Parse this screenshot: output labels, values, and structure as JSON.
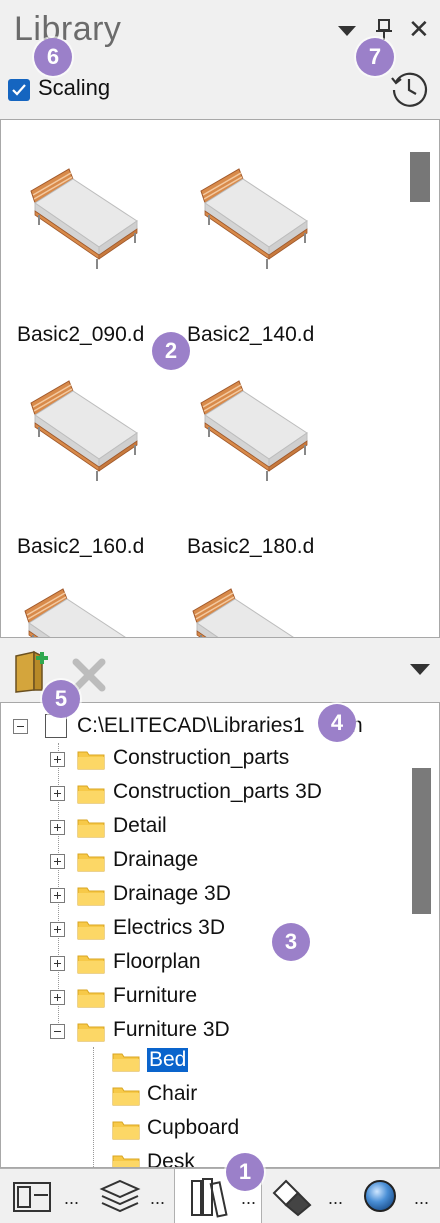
{
  "title": "Library",
  "scaling": {
    "label": "Scaling",
    "checked": true
  },
  "thumbnails": [
    {
      "caption": "Basic2_090.d"
    },
    {
      "caption": "Basic2_140.d"
    },
    {
      "caption": "Basic2_160.d"
    },
    {
      "caption": "Basic2_180.d"
    },
    {
      "caption": ""
    },
    {
      "caption": ""
    }
  ],
  "tree": {
    "root": "C:\\ELITECAD\\Libraries1",
    "root_tail": "n",
    "items": [
      {
        "label": "Construction_parts",
        "expander": "plus"
      },
      {
        "label": "Construction_parts 3D",
        "expander": "plus"
      },
      {
        "label": "Detail",
        "expander": "plus"
      },
      {
        "label": "Drainage",
        "expander": "plus"
      },
      {
        "label": "Drainage 3D",
        "expander": "plus"
      },
      {
        "label": "Electrics 3D",
        "expander": "plus"
      },
      {
        "label": "Floorplan",
        "expander": "plus"
      },
      {
        "label": "Furniture",
        "expander": "plus"
      },
      {
        "label": "Furniture 3D",
        "expander": "minus"
      }
    ],
    "children": [
      {
        "label": "Bed",
        "selected": true
      },
      {
        "label": "Chair"
      },
      {
        "label": "Cupboard"
      },
      {
        "label": "Desk"
      }
    ]
  },
  "bottom_tabs": [
    {
      "icon": "layout-icon",
      "ellipsis": "..."
    },
    {
      "icon": "layers-icon",
      "ellipsis": "..."
    },
    {
      "icon": "library-books-icon",
      "ellipsis": "...",
      "active": true
    },
    {
      "icon": "eraser-icon",
      "ellipsis": "..."
    },
    {
      "icon": "globe-icon",
      "ellipsis": "..."
    }
  ],
  "badges": {
    "b1": "1",
    "b2": "2",
    "b3": "3",
    "b4": "4",
    "b5": "5",
    "b6": "6",
    "b7": "7"
  },
  "colors": {
    "accent": "#0a64cc",
    "badge": "#9b80c9",
    "folder": "#f7c948"
  }
}
